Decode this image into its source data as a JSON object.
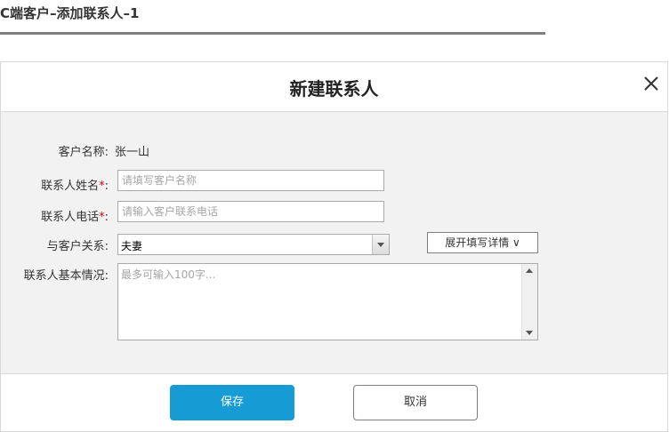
{
  "page": {
    "title": "C端客户–添加联系人–1"
  },
  "dialog": {
    "title": "新建联系人",
    "customer_name_label": "客户名称:",
    "customer_name_value": "张一山",
    "contact_name_label": "联系人姓名",
    "contact_name_placeholder": "请填写客户名称",
    "contact_phone_label": "联系人电话",
    "contact_phone_placeholder": "请输入客户联系电话",
    "required_mark": "*",
    "label_colon": ":",
    "relation_label": "与客户关系:",
    "relation_value": "夫妻",
    "expand_label": "展开填写详情 ∨",
    "basic_info_label": "联系人基本情况:",
    "basic_info_placeholder": "最多可输入100字...",
    "save_label": "保存",
    "cancel_label": "取消"
  },
  "colors": {
    "primary": "#169bd5",
    "required": "#d9001b",
    "body_bg": "#f2f2f2"
  },
  "icons": {
    "close": "close-icon",
    "dropdown": "chevron-down-icon"
  }
}
